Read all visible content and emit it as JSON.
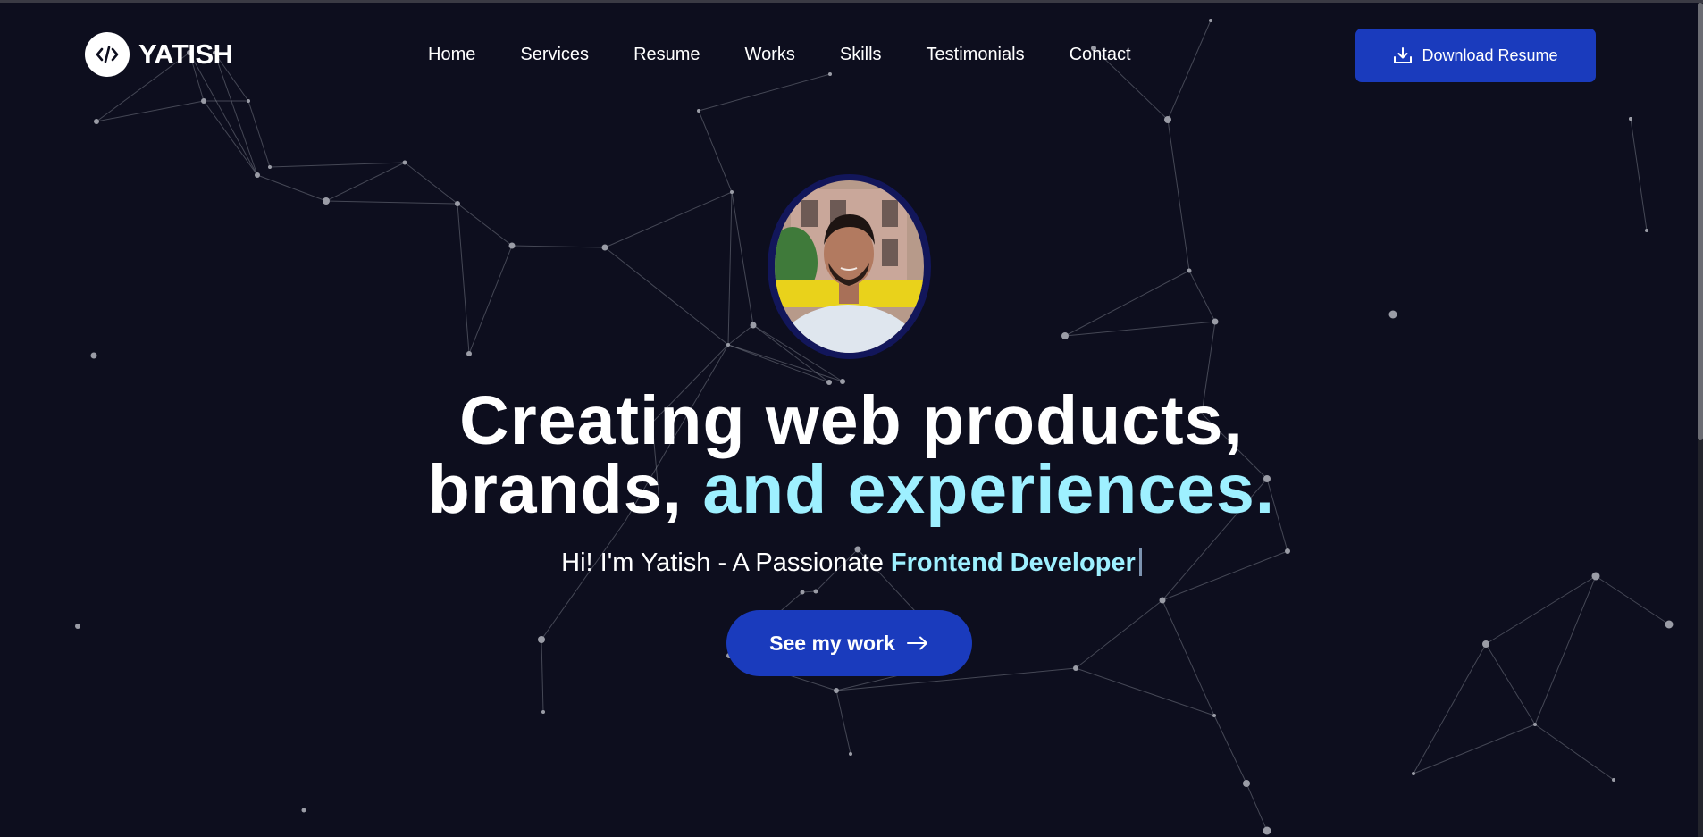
{
  "brand": {
    "name": "YATISH",
    "logo_icon": "code-icon"
  },
  "nav": {
    "items": [
      "Home",
      "Services",
      "Resume",
      "Works",
      "Skills",
      "Testimonials",
      "Contact"
    ],
    "download_label": "Download Resume",
    "download_icon": "download-icon"
  },
  "hero": {
    "headline_line1": "Creating web products,",
    "headline_line2_plain": "brands, ",
    "headline_line2_accent": "and experiences.",
    "intro": "Hi! I'm Yatish - A Passionate",
    "role": "Frontend Developer",
    "cta_label": "See my work",
    "cta_icon": "arrow-right-icon",
    "photo": "profile-photo"
  },
  "colors": {
    "background": "#0d0e1e",
    "accent": "#9ef0ff",
    "button": "#1a3bbd",
    "network": "#8a8d99"
  }
}
